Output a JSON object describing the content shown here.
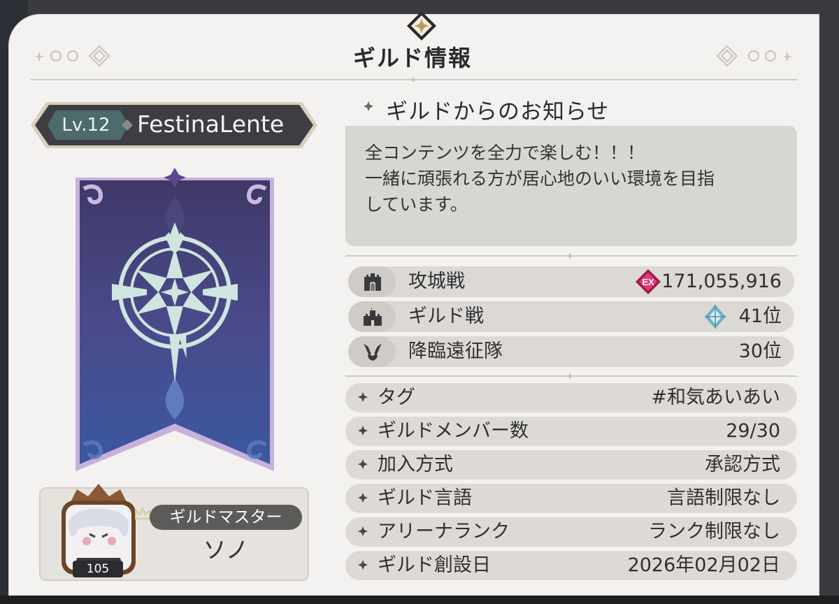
{
  "window": {
    "title": "ギルド情報"
  },
  "guild": {
    "level": "Lv.12",
    "name": "FestinaLente"
  },
  "master": {
    "tag": "ギルドマスター",
    "name": "ソノ",
    "level": "105"
  },
  "notice": {
    "heading": "ギルドからのお知らせ",
    "text": "全コンテンツを全力で楽しむ！！！\n一緒に頑張れる方が居心地のいい環境を目指\nしています。"
  },
  "rankings": [
    {
      "label": "攻城戦",
      "value": "171,055,916",
      "icon": "castle-gate-icon",
      "badge": "ex-rank-badge-icon"
    },
    {
      "label": "ギルド戦",
      "value": "41位",
      "icon": "castle-icon",
      "badge": "crystal-rank-badge-icon"
    },
    {
      "label": "降臨遠征隊",
      "value": "30位",
      "icon": "dragon-icon",
      "badge": ""
    }
  ],
  "info": [
    {
      "label": "タグ",
      "value": "#和気あいあい"
    },
    {
      "label": "ギルドメンバー数",
      "value": "29/30"
    },
    {
      "label": "加入方式",
      "value": "承認方式"
    },
    {
      "label": "ギルド言語",
      "value": "言語制限なし"
    },
    {
      "label": "アリーナランク",
      "value": "ランク制限なし"
    },
    {
      "label": "ギルド創設日",
      "value": "2026年02月02日"
    }
  ],
  "colors": {
    "panel": "#f3f2f0",
    "banner_top": "#4a3f7a",
    "banner_bottom": "#3a4f8c",
    "emblem": "#cfe5df",
    "row": "#dcd9d5"
  }
}
